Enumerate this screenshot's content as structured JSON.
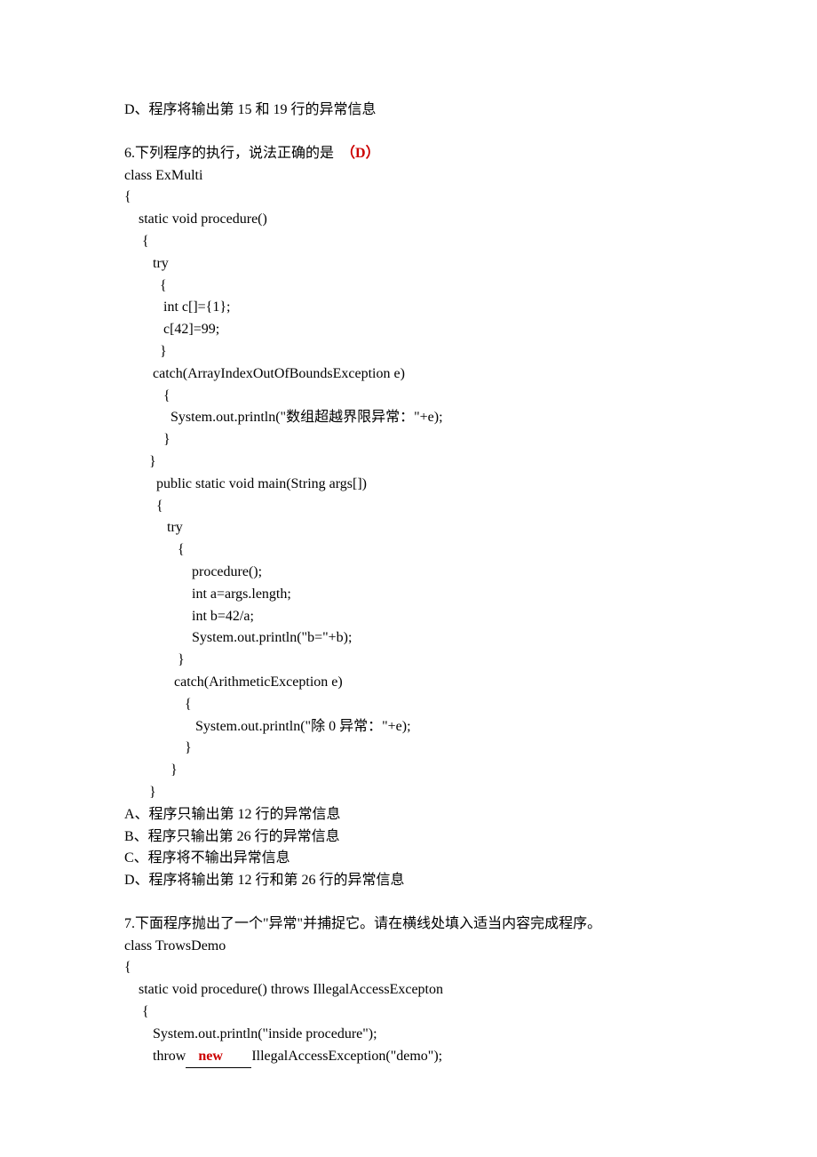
{
  "optD_prev": "D、程序将输出第 15 和 19 行的异常信息",
  "q6": {
    "stem_pre": "6.下列程序的执行，说法正确的是  ",
    "answer": "（D）",
    "code": [
      "class ExMulti",
      "{",
      "    static void procedure()",
      "     {",
      "        try",
      "          {",
      "           int c[]={1};",
      "           c[42]=99;",
      "          }",
      "        catch(ArrayIndexOutOfBoundsException e)",
      "           {",
      "             System.out.println(\"数组超越界限异常：\"+e);",
      "           }",
      "       }",
      "         public static void main(String args[])",
      "         {",
      "            try",
      "               {",
      "                   procedure();",
      "                   int a=args.length;",
      "                   int b=42/a;",
      "                   System.out.println(\"b=\"+b);",
      "               }",
      "              catch(ArithmeticException e)",
      "                 {",
      "                    System.out.println(\"除 0 异常：\"+e);",
      "                 }",
      "             }",
      "       }"
    ],
    "options": [
      "A、程序只输出第 12 行的异常信息",
      "B、程序只输出第 26 行的异常信息",
      "C、程序将不输出异常信息",
      "D、程序将输出第 12 行和第 26 行的异常信息"
    ]
  },
  "q7": {
    "stem": "7.下面程序抛出了一个\"异常\"并捕捉它。请在横线处填入适当内容完成程序。",
    "code_pre": [
      "class TrowsDemo",
      "{",
      "    static void procedure() throws IllegalAccessExcepton",
      "     {",
      "        System.out.println(\"inside procedure\");"
    ],
    "throw_kw": "        throw",
    "blank_fill": "   new      ",
    "throw_tail": "IllegalAccessException(\"demo\");"
  }
}
